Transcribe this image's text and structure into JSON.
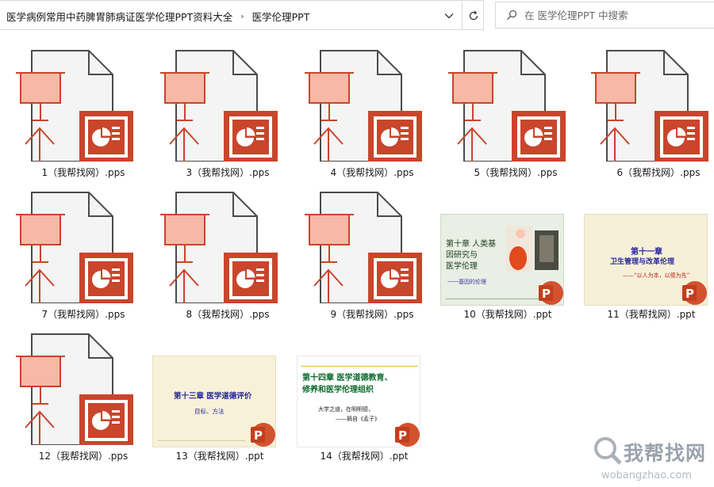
{
  "breadcrumb": {
    "parent": "医学病例常用中药脾胃肺病证医学伦理PPT资料大全",
    "separator": "›",
    "current": "医学伦理PPT"
  },
  "search": {
    "placeholder": "在 医学伦理PPT 中搜索"
  },
  "files": [
    {
      "name": "1（我帮找网）.pps"
    },
    {
      "name": "3（我帮找网）.pps"
    },
    {
      "name": "4（我帮找网）.pps"
    },
    {
      "name": "5（我帮找网）.pps"
    },
    {
      "name": "6（我帮找网）.pps"
    },
    {
      "name": "7（我帮找网）.pps"
    },
    {
      "name": "8（我帮找网）.pps"
    },
    {
      "name": "9（我帮找网）.pps"
    },
    {
      "name": "10（我帮找网）.ppt"
    },
    {
      "name": "11（我帮找网）.ppt"
    },
    {
      "name": "12（我帮找网）.pps"
    },
    {
      "name": "13（我帮找网）.ppt"
    },
    {
      "name": "14（我帮找网）.ppt"
    }
  ],
  "slides": {
    "s10": {
      "l1": "第十章 人类基",
      "l2": "因研究与",
      "l3": "医学伦理",
      "l4": "一一基因的伦理"
    },
    "s11": {
      "title": "第十一章",
      "sub": "卫生管理与改革伦理",
      "quote": "——“以人为本，以德为先”"
    },
    "s13": {
      "title": "第十三章 医学道德评价",
      "sub": "目标、方法"
    },
    "s14": {
      "title1": "第十四章 医学道德教育、",
      "title2": "修养和医学伦理组织",
      "q1": "大学之道，在明明德，",
      "q2": "——摘自《孟子》"
    }
  },
  "watermark": {
    "text": "我帮找网",
    "url": "wobangzhao.com"
  },
  "colors": {
    "ppt_orange": "#c9452b",
    "ppt_light": "#f6b9a6",
    "doc_outline": "#4b4b4b",
    "slide_green": "#0b6b2e"
  },
  "icons": {
    "dropdown": "chevron-down-icon",
    "refresh": "refresh-icon",
    "search": "search-icon",
    "pps_file": "pps-file-icon",
    "ppt_badge": "ppt-badge-icon"
  }
}
